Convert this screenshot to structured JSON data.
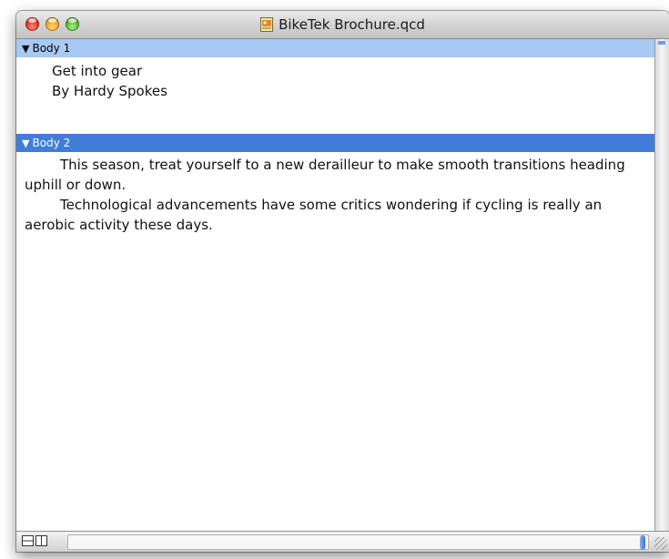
{
  "window": {
    "title": "BikeTek Brochure.qcd"
  },
  "sections": [
    {
      "header": "Body 1",
      "lines": [
        "Get into gear",
        "By Hardy Spokes"
      ]
    },
    {
      "header": "Body 2",
      "paragraphs": [
        "This season, treat yourself to a new derailleur to make smooth transitions heading uphill or down.",
        "Technological advancements have some critics wondering if cycling is really an aerobic activity these days."
      ]
    }
  ],
  "icons": {
    "disclosure": "disclosure-triangle-icon",
    "document": "document-icon"
  },
  "colors": {
    "header_selected": "#3f7dd8",
    "header_unselected": "#a9c9f5"
  }
}
